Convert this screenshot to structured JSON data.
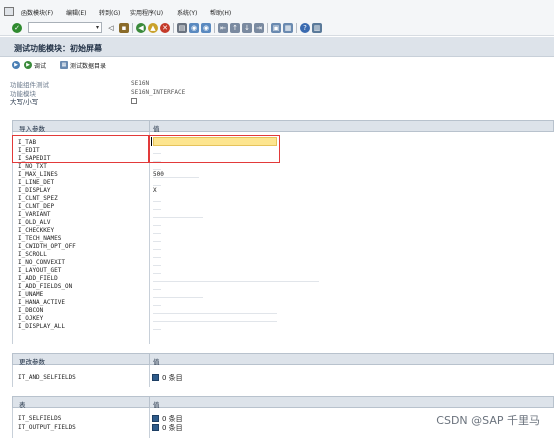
{
  "menu": {
    "items": [
      "函数模块(F)",
      "编辑(E)",
      "转到(G)",
      "实用程序(U)",
      "系统(Y)",
      "帮助(H)"
    ]
  },
  "toolbar": {
    "command_value": "",
    "dropdown_glyph": "▾"
  },
  "title": "测试功能模块：初始屏幕",
  "app_toolbar": {
    "debug_label": "调试",
    "test_data_label": "测试数据目录"
  },
  "header_info": {
    "test_env_label": "功能组件测试",
    "test_env_value": "SE16N",
    "function_module_label": "功能模块",
    "function_module_value": "SE16N_INTERFACE",
    "case_label": "大写/小写"
  },
  "import_table": {
    "col1": "导入参数",
    "col2": "值",
    "params": [
      "I_TAB",
      "I_EDIT",
      "I_SAPEDIT",
      "I_NO_TXT",
      "I_MAX_LINES",
      "I_LINE_DET",
      "I_DISPLAY",
      "I_CLNT_SPEZ",
      "I_CLNT_DEP",
      "I_VARIANT",
      "I_OLD_ALV",
      "I_CHECKKEY",
      "I_TECH_NAMES",
      "I_CWIDTH_OPT_OFF",
      "I_SCROLL",
      "I_NO_CONVEXIT",
      "I_LAYOUT_GET",
      "I_ADD_FIELD",
      "I_ADD_FIELDS_ON",
      "I_UNAME",
      "I_HANA_ACTIVE",
      "I_DBCON",
      "I_OJKEY",
      "I_DISPLAY_ALL"
    ],
    "max_lines_value": "500",
    "display_value": "X"
  },
  "changing_table": {
    "col1": "更改参数",
    "col2": "值",
    "param": "IT_AND_SELFIELDS",
    "entries": "0 条目"
  },
  "tables_table": {
    "col1": "表",
    "col2": "值",
    "params": [
      "IT_SELFIELDS",
      "IT_OUTPUT_FIELDS"
    ],
    "entries": [
      "0 条目",
      "0 条目"
    ]
  },
  "watermark": "CSDN @SAP 千里马"
}
